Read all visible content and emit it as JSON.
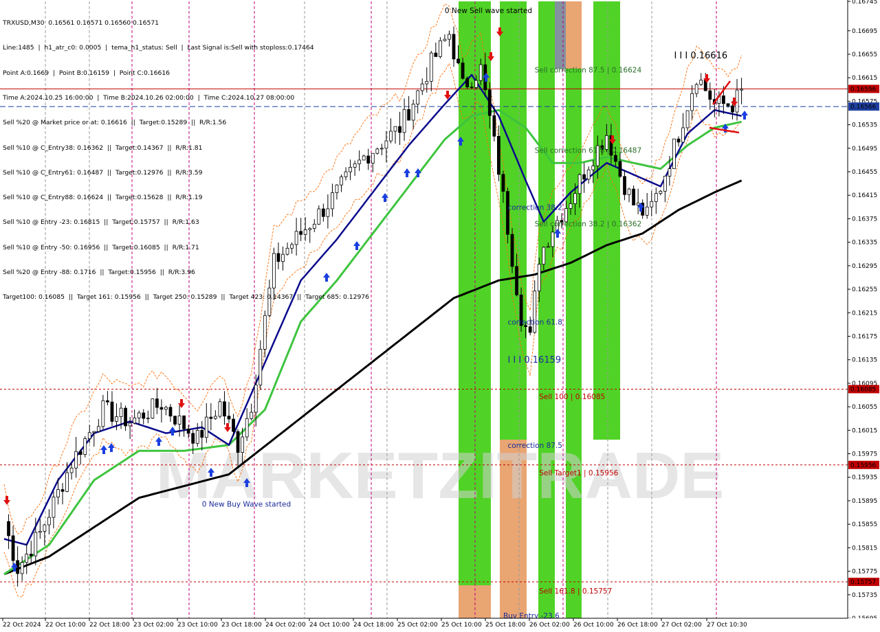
{
  "window": {
    "symbol_line": "TRXUSD,M30  0.16561 0.16571 0.16560 0.16571"
  },
  "info_lines": [
    "Line:1485  |  h1_atr_c0: 0.0005  |  tema_h1_status: Sell  |  Last Signal is:Sell with stoploss:0.17464",
    "Point A:0.1669  |  Point B:0.16159  |  Point C:0.16616",
    "Time A:2024.10.25 16:00:00  |  Time B:2024.10.26 02:00:00  |  Time C:2024.10.27 08:00:00",
    "Sell %20 @ Market price or at: 0.16616  ||  Target:0.15289  ||  R/R:1.56",
    "Sell %10 @ C_Entry38: 0.16362  ||  Target:0.14367  ||  R/R:1.81",
    "Sell %10 @ C_Entry61: 0.16487  ||  Target:0.12976  ||  R/R:3.59",
    "Sell %10 @ C_Entry88: 0.16624  ||  Target:0.15628  ||  R/R:1.19",
    "Sell %10 @ Entry -23: 0.16815  ||  Target:0.15757  ||  R/R:1.63",
    "Sell %10 @ Entry -50: 0.16956  ||  Target:0.16085  ||  R/R:1.71",
    "Sell %20 @ Entry -88: 0.1716  ||  Target:0.15956  ||  R/R:3.96",
    "Target100: 0.16085  ||  Target 161: 0.15956  ||  Target 250: 0.15289  ||  Target 423: 0.14367  ||  Target 685: 0.12976"
  ],
  "watermark": "MARKETZITRADE",
  "colors": {
    "bg": "#ffffff",
    "candle": "#000000",
    "ma_fast": "#0a0a8c",
    "ma_mid": "#3ec43e",
    "ma_slow": "#000000",
    "channel": "#ff6a00",
    "zone_green": "#47d11a",
    "zone_orange": "#e8a06a",
    "zone_grey": "#7d8b99",
    "level_red": "#c00000",
    "level_blue": "#1e3fa0",
    "arrow_up": "#1a3fe0",
    "arrow_down": "#e01010",
    "vline_magenta": "#c0007a",
    "vline_grey": "#9a9a9a"
  },
  "chart_data": {
    "type": "candlestick",
    "symbol": "TRXUSD",
    "timeframe": "M30",
    "ylim": [
      0.15695,
      0.16745
    ],
    "y_ticks": [
      "0.16745",
      "0.16695",
      "0.16655",
      "0.16615",
      "0.16575",
      "0.16535",
      "0.16495",
      "0.16455",
      "0.16415",
      "0.16375",
      "0.16335",
      "0.16295",
      "0.16255",
      "0.16215",
      "0.16175",
      "0.16135",
      "0.16095",
      "0.16055",
      "0.16015",
      "0.15975",
      "0.15935",
      "0.15895",
      "0.15855",
      "0.15815",
      "0.15775",
      "0.15735",
      "0.15695"
    ],
    "x_ticks": [
      "22 Oct 2024",
      "22 Oct 10:00",
      "22 Oct 18:00",
      "23 Oct 02:00",
      "23 Oct 10:00",
      "23 Oct 18:00",
      "24 Oct 02:00",
      "24 Oct 10:00",
      "24 Oct 18:00",
      "25 Oct 02:00",
      "25 Oct 10:00",
      "25 Oct 18:00",
      "26 Oct 02:00",
      "26 Oct 10:00",
      "26 Oct 18:00",
      "27 Oct 02:00",
      "27 Oct 10:30"
    ],
    "price_path": [
      [
        0,
        0.1586
      ],
      [
        3,
        0.1578
      ],
      [
        8,
        0.1584
      ],
      [
        15,
        0.1596
      ],
      [
        22,
        0.1605
      ],
      [
        28,
        0.1603
      ],
      [
        35,
        0.1606
      ],
      [
        43,
        0.16
      ],
      [
        48,
        0.1606
      ],
      [
        52,
        0.1599
      ],
      [
        55,
        0.1606
      ],
      [
        60,
        0.163
      ],
      [
        66,
        0.1635
      ],
      [
        72,
        0.164
      ],
      [
        80,
        0.1648
      ],
      [
        88,
        0.1653
      ],
      [
        92,
        0.1659
      ],
      [
        95,
        0.1664
      ],
      [
        99,
        0.1669
      ],
      [
        102,
        0.166
      ],
      [
        106,
        0.1663
      ],
      [
        110,
        0.1646
      ],
      [
        115,
        0.1621
      ],
      [
        117,
        0.1617
      ],
      [
        119,
        0.1631
      ],
      [
        122,
        0.1636
      ],
      [
        126,
        0.1641
      ],
      [
        130,
        0.1647
      ],
      [
        134,
        0.1652
      ],
      [
        137,
        0.1645
      ],
      [
        140,
        0.164
      ],
      [
        143,
        0.1638
      ],
      [
        146,
        0.1643
      ],
      [
        150,
        0.1652
      ],
      [
        154,
        0.1662
      ],
      [
        158,
        0.1657
      ],
      [
        162,
        0.1657
      ],
      [
        164,
        0.1659
      ]
    ],
    "ma_fast_path": [
      [
        0,
        0.1583
      ],
      [
        5,
        0.1582
      ],
      [
        12,
        0.1593
      ],
      [
        20,
        0.1601
      ],
      [
        28,
        0.1603
      ],
      [
        36,
        0.1601
      ],
      [
        44,
        0.1602
      ],
      [
        50,
        0.1599
      ],
      [
        58,
        0.1613
      ],
      [
        66,
        0.1627
      ],
      [
        74,
        0.1634
      ],
      [
        82,
        0.1642
      ],
      [
        90,
        0.165
      ],
      [
        98,
        0.1657
      ],
      [
        104,
        0.1662
      ],
      [
        110,
        0.1655
      ],
      [
        116,
        0.1644
      ],
      [
        120,
        0.1637
      ],
      [
        126,
        0.1642
      ],
      [
        134,
        0.1647
      ],
      [
        140,
        0.1645
      ],
      [
        146,
        0.1643
      ],
      [
        152,
        0.1652
      ],
      [
        158,
        0.1656
      ],
      [
        164,
        0.1655
      ]
    ],
    "ma_mid_path": [
      [
        0,
        0.1577
      ],
      [
        10,
        0.1582
      ],
      [
        20,
        0.1593
      ],
      [
        30,
        0.1598
      ],
      [
        40,
        0.1598
      ],
      [
        50,
        0.1599
      ],
      [
        58,
        0.1605
      ],
      [
        66,
        0.162
      ],
      [
        74,
        0.1627
      ],
      [
        82,
        0.1635
      ],
      [
        90,
        0.1643
      ],
      [
        98,
        0.1651
      ],
      [
        104,
        0.1655
      ],
      [
        110,
        0.1656
      ],
      [
        116,
        0.1653
      ],
      [
        122,
        0.1647
      ],
      [
        128,
        0.1647
      ],
      [
        134,
        0.1648
      ],
      [
        140,
        0.1647
      ],
      [
        146,
        0.1646
      ],
      [
        152,
        0.165
      ],
      [
        158,
        0.1653
      ],
      [
        164,
        0.1654
      ]
    ],
    "ma_slow_path": [
      [
        0,
        0.1577
      ],
      [
        10,
        0.158
      ],
      [
        20,
        0.1585
      ],
      [
        30,
        0.159
      ],
      [
        40,
        0.1592
      ],
      [
        50,
        0.1594
      ],
      [
        60,
        0.16
      ],
      [
        70,
        0.1606
      ],
      [
        80,
        0.1612
      ],
      [
        90,
        0.1618
      ],
      [
        100,
        0.1624
      ],
      [
        110,
        0.1627
      ],
      [
        118,
        0.1628
      ],
      [
        126,
        0.163
      ],
      [
        134,
        0.1633
      ],
      [
        142,
        0.1635
      ],
      [
        150,
        0.1639
      ],
      [
        158,
        0.1642
      ],
      [
        164,
        0.1644
      ]
    ],
    "levels": [
      {
        "label": "0.16596",
        "value": 0.16596,
        "color": "#c00000",
        "style": "solid"
      },
      {
        "label": "0.16566",
        "value": 0.16566,
        "color": "#1e3fa0",
        "style": "dashed"
      },
      {
        "label": "0.16085",
        "value": 0.16085,
        "color": "#c00000",
        "style": "dotted"
      },
      {
        "label": "0.15956",
        "value": 0.15956,
        "color": "#c00000",
        "style": "dotted"
      },
      {
        "label": "0.15757",
        "value": 0.15757,
        "color": "#c00000",
        "style": "dotted"
      }
    ],
    "annotations": [
      {
        "text": "0 New Sell wave started",
        "bar": 98,
        "price": 0.16725,
        "color": "#000000"
      },
      {
        "text": "Sell correction 87.5 | 0.16624",
        "bar": 118,
        "price": 0.16624,
        "color": "#2a6e2a"
      },
      {
        "text": "I I I  0.16616",
        "bar": 149,
        "price": 0.16648,
        "color": "#000000",
        "size": 13
      },
      {
        "text": "Sell correction 61.8 | 0.16487",
        "bar": 118,
        "price": 0.16487,
        "color": "#2a6e2a"
      },
      {
        "text": "correction 38.2",
        "bar": 112,
        "price": 0.1639,
        "color": "#1a2a9a"
      },
      {
        "text": "Sell correction 38.2 | 0.16362",
        "bar": 118,
        "price": 0.16362,
        "color": "#2a6e2a"
      },
      {
        "text": "correction 61.8",
        "bar": 112,
        "price": 0.16195,
        "color": "#1a2a9a"
      },
      {
        "text": "I I I  0.16159",
        "bar": 112,
        "price": 0.1613,
        "color": "#1a2a9a",
        "size": 13
      },
      {
        "text": "Sell 100 | 0.16085",
        "bar": 119,
        "price": 0.16068,
        "color": "#c00000"
      },
      {
        "text": "correction 87.5",
        "bar": 112,
        "price": 0.15985,
        "color": "#1a2a9a"
      },
      {
        "text": "Sell Target1 | 0.15956",
        "bar": 119,
        "price": 0.15938,
        "color": "#c00000"
      },
      {
        "text": "0 New Buy Wave started",
        "bar": 44,
        "price": 0.15885,
        "color": "#1a2a9a"
      },
      {
        "text": "Sell 161.8 | 0.15757",
        "bar": 119,
        "price": 0.15737,
        "color": "#c00000"
      },
      {
        "text": "Buy Entry -23.6",
        "bar": 111,
        "price": 0.15695,
        "color": "#1a2a9a"
      }
    ]
  }
}
